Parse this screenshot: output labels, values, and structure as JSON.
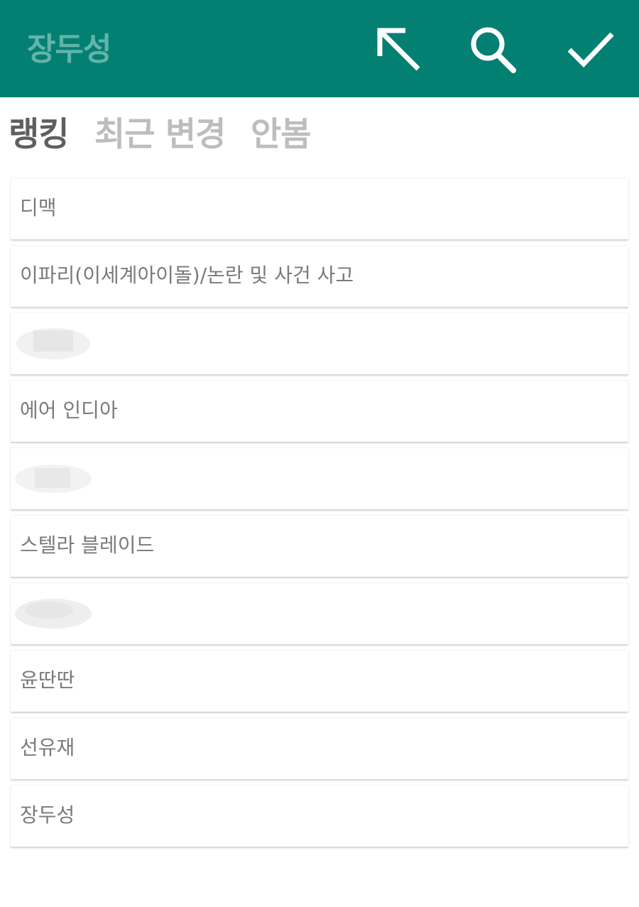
{
  "header": {
    "title": "장두성",
    "actions": [
      {
        "name": "top-left-arrow-icon",
        "label": "back to top"
      },
      {
        "name": "search-icon",
        "label": "search"
      },
      {
        "name": "check-icon",
        "label": "confirm"
      }
    ],
    "colors": {
      "bar": "#048073",
      "title": "#62b4aa",
      "icons": "#ffffff"
    }
  },
  "tabs": [
    {
      "label": "랭킹",
      "active": true
    },
    {
      "label": "최근 변경",
      "active": false
    },
    {
      "label": "안봄",
      "active": false
    }
  ],
  "ranking": {
    "items": [
      {
        "label": "디맥",
        "redacted": false
      },
      {
        "label": "이파리(이세계아이돌)/논란 및 사건 사고",
        "redacted": false
      },
      {
        "label": "",
        "redacted": true
      },
      {
        "label": "에어 인디아",
        "redacted": false
      },
      {
        "label": "",
        "redacted": true
      },
      {
        "label": "스텔라 블레이드",
        "redacted": false
      },
      {
        "label": "",
        "redacted": true
      },
      {
        "label": "윤딴딴",
        "redacted": false
      },
      {
        "label": "선유재",
        "redacted": false
      },
      {
        "label": "장두성",
        "redacted": false
      }
    ]
  }
}
